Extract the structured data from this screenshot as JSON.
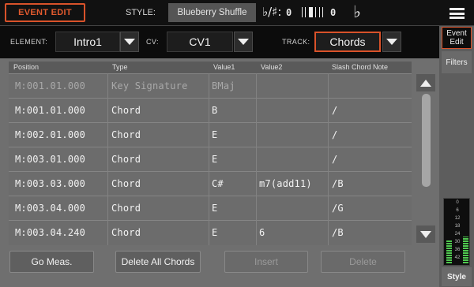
{
  "topbar": {
    "mode_button": "EVENT EDIT",
    "style_label": "STYLE:",
    "style_value": "Blueberry Shuffle",
    "key_sig_icon": "♭/♯:",
    "key_sig_value": "0",
    "keyboard_icon": "keyboard-icon",
    "transpose_value": "0",
    "flat_icon": "♭",
    "menu_icon": "menu-icon"
  },
  "selectors": {
    "element_label": "ELEMENT:",
    "element_value": "Intro1",
    "cv_label": "CV:",
    "cv_value": "CV1",
    "track_label": "TRACK:",
    "track_value": "Chords"
  },
  "sidebar": {
    "tab_event_edit": "Event Edit",
    "tab_filters": "Filters",
    "meter_scale": [
      "0",
      "6",
      "12",
      "18",
      "24",
      "30",
      "36",
      "42"
    ],
    "meter_levels": [
      0.38,
      0.42
    ],
    "tab_style": "Style"
  },
  "table": {
    "columns": [
      "Position",
      "Type",
      "Value1",
      "Value2",
      "Slash Chord Note"
    ],
    "rows": [
      {
        "position": "M:001.01.000",
        "type": "Key Signature",
        "value1": "BMaj",
        "value2": "",
        "slash": ""
      },
      {
        "position": "M:001.01.000",
        "type": "Chord",
        "value1": "B",
        "value2": "",
        "slash": "/"
      },
      {
        "position": "M:002.01.000",
        "type": "Chord",
        "value1": "E",
        "value2": "",
        "slash": "/"
      },
      {
        "position": "M:003.01.000",
        "type": "Chord",
        "value1": "E",
        "value2": "",
        "slash": "/"
      },
      {
        "position": "M:003.03.000",
        "type": "Chord",
        "value1": "C#",
        "value2": "m7(add11)",
        "slash": "/B"
      },
      {
        "position": "M:003.04.000",
        "type": "Chord",
        "value1": "E",
        "value2": "",
        "slash": "/G"
      },
      {
        "position": "M:003.04.240",
        "type": "Chord",
        "value1": "E",
        "value2": "6",
        "slash": "/B"
      }
    ]
  },
  "buttons": {
    "go_meas": "Go Meas.",
    "delete_all": "Delete All Chords",
    "insert": "Insert",
    "delete": "Delete"
  },
  "colors": {
    "accent": "#d9522a",
    "meter_green": "#4fc84f"
  }
}
